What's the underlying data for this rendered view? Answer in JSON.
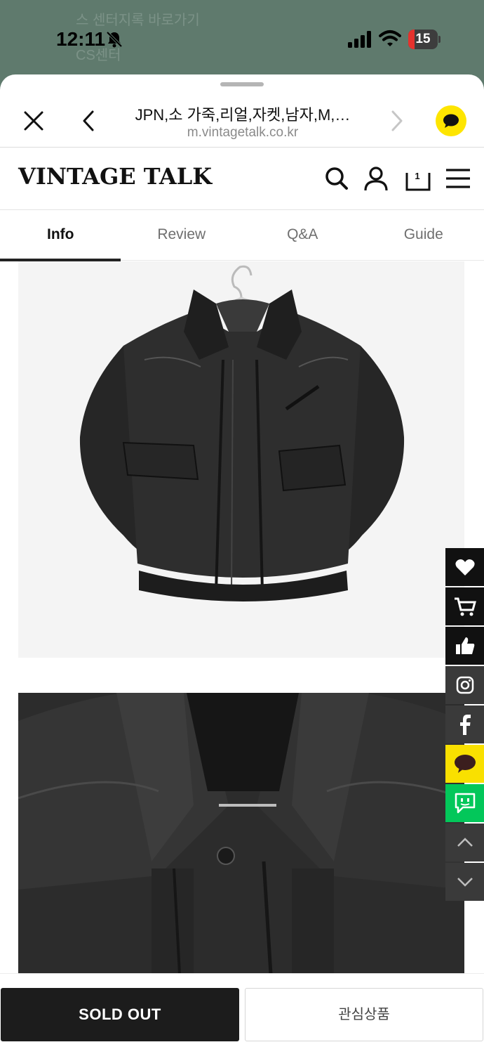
{
  "status_bar": {
    "time": "12:11",
    "battery_level": "15",
    "battery_fraction": 0.15,
    "battery_color": "#e5322d",
    "behind_text": [
      "스 센터지록 바로가기",
      "CS센터"
    ]
  },
  "browser": {
    "page_title": "JPN,소 가죽,리얼,자켓,남자,M,…",
    "domain": "m.vintagetalk.co.kr",
    "close_icon": "close-icon",
    "back_icon": "chevron-left-icon",
    "forward_icon": "chevron-right-icon",
    "kakao_icon": "kakaotalk-icon"
  },
  "site_header": {
    "logo": "VINTAGE TALK",
    "cart_count": "1",
    "icons": [
      "search-icon",
      "user-icon",
      "cart-icon",
      "menu-icon"
    ]
  },
  "tabs": [
    {
      "label": "Info",
      "active": true
    },
    {
      "label": "Review",
      "active": false
    },
    {
      "label": "Q&A",
      "active": false
    },
    {
      "label": "Guide",
      "active": false
    }
  ],
  "images": [
    {
      "name": "black leather jacket front view"
    },
    {
      "name": "black leather jacket collar closeup"
    }
  ],
  "side_buttons": [
    {
      "icon": "heart-icon",
      "bg": "#111111"
    },
    {
      "icon": "cart-icon",
      "bg": "#111111"
    },
    {
      "icon": "thumbs-up-icon",
      "bg": "#111111"
    },
    {
      "icon": "instagram-icon",
      "bg": "#3a3a3a"
    },
    {
      "icon": "facebook-icon",
      "bg": "#3a3a3a"
    },
    {
      "icon": "kakao-chat-icon",
      "bg": "#f9e000"
    },
    {
      "icon": "naver-talk-icon",
      "bg": "#03c75a"
    },
    {
      "icon": "chevron-up-icon",
      "bg": "#3a3a3a"
    },
    {
      "icon": "chevron-down-icon",
      "bg": "#3a3a3a"
    }
  ],
  "bottom_bar": {
    "sold_out_label": "SOLD OUT",
    "wishlist_label": "관심상품"
  }
}
